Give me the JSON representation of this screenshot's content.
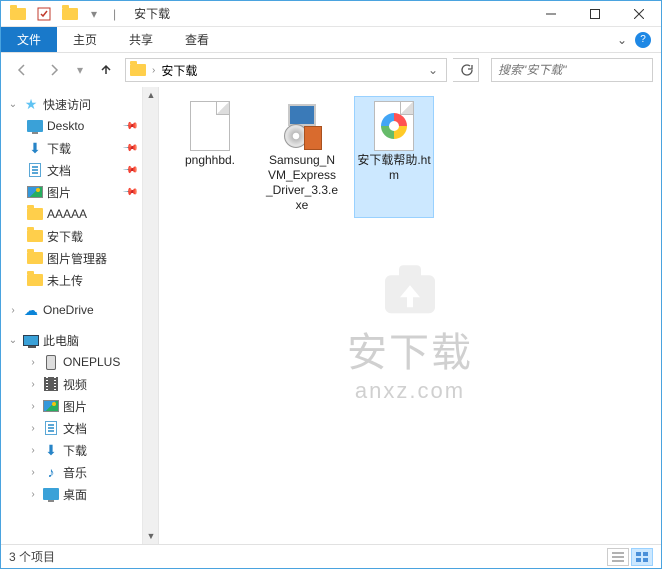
{
  "window": {
    "title": "安下载",
    "separator": "|"
  },
  "ribbon": {
    "tabs": {
      "file": "文件",
      "home": "主页",
      "share": "共享",
      "view": "查看"
    }
  },
  "address": {
    "crumb_root": "",
    "crumb_current": "安下载"
  },
  "search": {
    "placeholder": "搜索\"安下载\""
  },
  "nav": {
    "quick_access": "快速访问",
    "items": [
      {
        "label": "Deskto",
        "icon": "desktop",
        "pinned": true
      },
      {
        "label": "下载",
        "icon": "download",
        "pinned": true
      },
      {
        "label": "文档",
        "icon": "doc",
        "pinned": true
      },
      {
        "label": "图片",
        "icon": "pic",
        "pinned": true
      },
      {
        "label": "AAAAA",
        "icon": "folder",
        "pinned": false
      },
      {
        "label": "安下载",
        "icon": "folder",
        "pinned": false
      },
      {
        "label": "图片管理器",
        "icon": "folder",
        "pinned": false
      },
      {
        "label": "未上传",
        "icon": "folder",
        "pinned": false
      }
    ],
    "onedrive": "OneDrive",
    "this_pc": "此电脑",
    "pc_items": [
      {
        "label": "ONEPLUS",
        "icon": "phone"
      },
      {
        "label": "视频",
        "icon": "video"
      },
      {
        "label": "图片",
        "icon": "pic"
      },
      {
        "label": "文档",
        "icon": "doc"
      },
      {
        "label": "下载",
        "icon": "download"
      },
      {
        "label": "音乐",
        "icon": "music"
      },
      {
        "label": "桌面",
        "icon": "desktop"
      }
    ]
  },
  "files": [
    {
      "name": "pnghhbd.",
      "type": "blank",
      "selected": false
    },
    {
      "name": "Samsung_NVM_Express_Driver_3.3.exe",
      "type": "exe",
      "selected": false
    },
    {
      "name": "安下载帮助.htm",
      "type": "htm",
      "selected": true
    }
  ],
  "status": {
    "text": "3 个项目"
  },
  "watermark": {
    "text": "安下载",
    "url": "anxz.com"
  }
}
